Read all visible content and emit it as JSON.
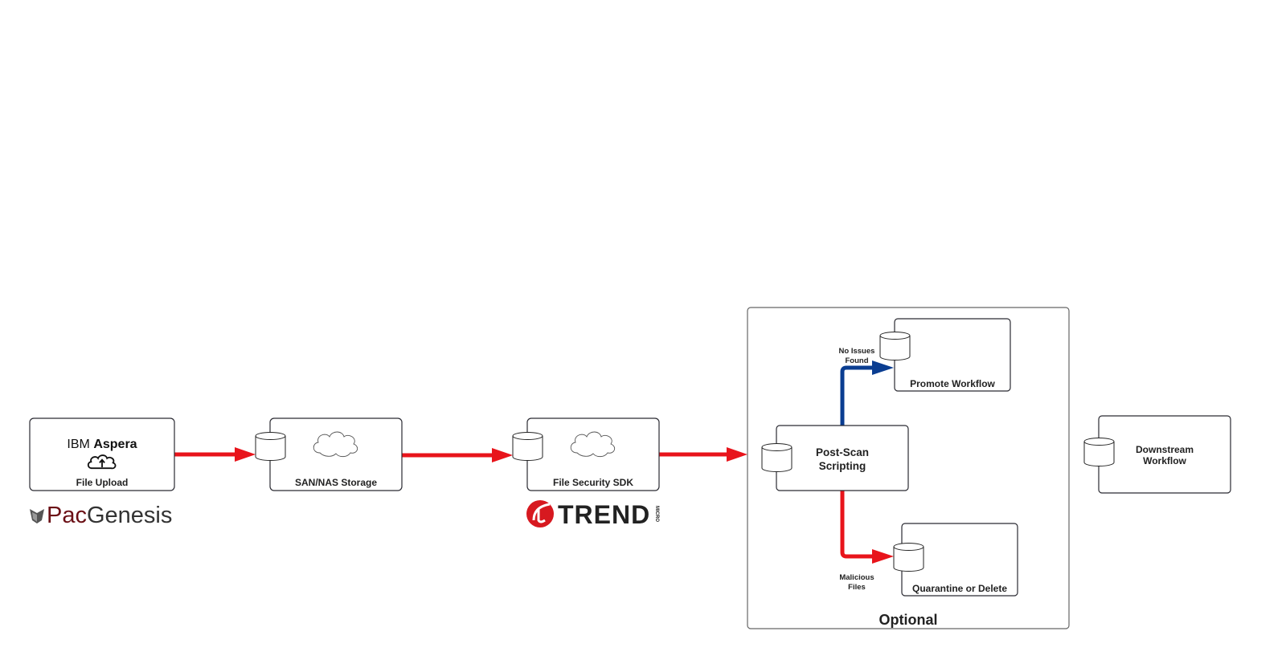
{
  "colors": {
    "flow": "#e8141b",
    "clean": "#0a3d91",
    "pacgenesis": "#6b1016",
    "trend": "#d71920"
  },
  "nodes": {
    "upload": {
      "brand_light": "IBM",
      "brand_bold": "Aspera",
      "label": "File Upload",
      "icon": "cloud-upload-icon"
    },
    "storage": {
      "label": "SAN/NAS Storage",
      "icon": "cloud-icon"
    },
    "sdk": {
      "label": "File Security SDK",
      "icon": "cloud-icon"
    },
    "postscan": {
      "line1": "Post-Scan",
      "line2": "Scripting"
    },
    "promote": {
      "label": "Promote Workflow"
    },
    "quarantine": {
      "label": "Quarantine or Delete"
    },
    "downstream": {
      "line1": "Downstream",
      "line2": "Workflow"
    }
  },
  "edges": {
    "clean": {
      "line1": "No Issues",
      "line2": "Found"
    },
    "malicious": {
      "line1": "Malicious",
      "line2": "Files"
    }
  },
  "group": {
    "label": "Optional"
  },
  "logos": {
    "pacgenesis_a": "Pac",
    "pacgenesis_b": "Genesis",
    "trend": "TREND",
    "trend_sub": "MICRO"
  }
}
